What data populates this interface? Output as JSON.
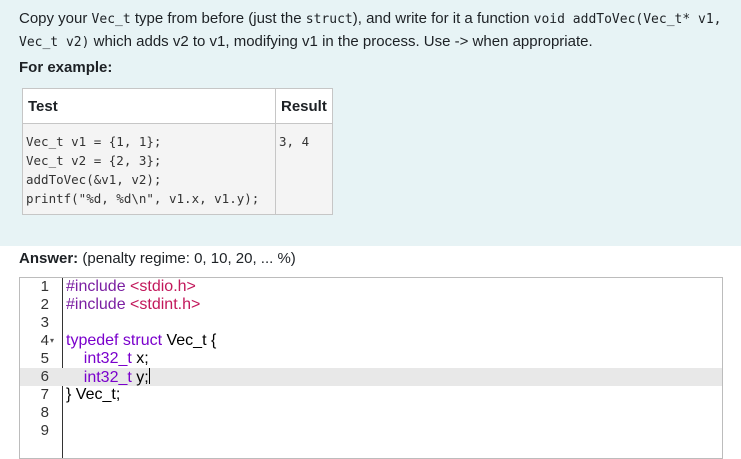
{
  "question": {
    "text_1": "Copy your ",
    "code_1": "Vec_t",
    "text_2": " type from before (just the ",
    "code_2": "struct",
    "text_3": "), and write for it a function ",
    "code_3": "void addToVec(Vec_t* v1, Vec_t v2)",
    "text_4": " which adds v2 to v1, modifying v1 in the process. Use -> when appropriate.",
    "for_example": "For example:"
  },
  "example_table": {
    "col_test": "Test",
    "col_result": "Result",
    "test_code": "Vec_t v1 = {1, 1};\nVec_t v2 = {2, 3};\naddToVec(&v1, v2);\nprintf(\"%d, %d\\n\", v1.x, v1.y);",
    "result": "3, 4"
  },
  "answer": {
    "label": "Answer:",
    "penalty": "(penalty regime: 0, 10, 20, ... %)"
  },
  "editor": {
    "line_numbers": [
      "1",
      "2",
      "3",
      "4",
      "5",
      "6",
      "7",
      "8",
      "9"
    ],
    "fold_marker": "▾",
    "lines": {
      "l1_a": "#include",
      "l1_b": " <stdio.h>",
      "l2_a": "#include",
      "l2_b": " <stdint.h>",
      "l4_a": "typedef",
      "l4_b": " struct",
      "l4_c": " Vec_t {",
      "l5_a": "    int32_t",
      "l5_b": " x;",
      "l6_a": "    int32_t",
      "l6_b": " y;",
      "l7": "} Vec_t;"
    },
    "active_line": 6
  },
  "colors": {
    "question_bg": "#e7f3f5",
    "keyword": "#7a00cc",
    "include_target": "#c2185b"
  }
}
